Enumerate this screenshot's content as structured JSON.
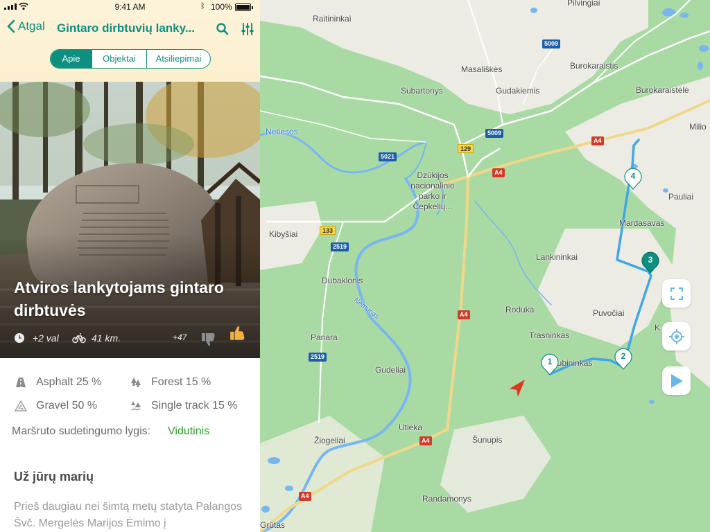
{
  "status_bar": {
    "time": "9:41 AM",
    "battery": "100%"
  },
  "nav": {
    "back_label": "Atgal",
    "title": "Gintaro dirbtuvių lanky...",
    "icons": {
      "search": "search-icon",
      "filter": "filter-sliders-icon"
    }
  },
  "tabs": [
    {
      "label": "Apie",
      "active": true
    },
    {
      "label": "Objektai",
      "active": false
    },
    {
      "label": "Atsiliepimai",
      "active": false
    }
  ],
  "hero": {
    "title": "Atviros lankytojams gintaro dirbtuvės",
    "duration": "+2 val",
    "distance": "41 km.",
    "likes": "+47"
  },
  "surfaces": [
    {
      "label": "Asphalt 25 %",
      "icon": "asphalt-icon"
    },
    {
      "label": "Forest 15 %",
      "icon": "forest-icon"
    },
    {
      "label": "Gravel 50 %",
      "icon": "gravel-icon"
    },
    {
      "label": "Single track 15 %",
      "icon": "single-track-icon"
    }
  ],
  "difficulty": {
    "label": "Maršruto sudetingumo lygis:",
    "value": "Vidutinis"
  },
  "description": {
    "title": "Už jūrų marių",
    "text": "Prieš daugiau nei šimtą metų statyta Palangos Švč. Mergelės Marijos Ėmimo į"
  },
  "map": {
    "places": [
      "Pilvingiai",
      "Raitininkai",
      "Masališkės",
      "Burokaraistis",
      "Subartonys",
      "Gudakiemis",
      "Burokaraistėlė",
      "Milio",
      "Netiesos",
      "Pauliai",
      "Mardasavas",
      "Kibyšiai",
      "Lankininkai",
      "Dubaklonis",
      "Roduka",
      "Puvočiai",
      "Trasninkas",
      "Dubininkas",
      "Panara",
      "Gudeliai",
      "Utieka",
      "Žiogeliai",
      "Šunupis",
      "Randamonys",
      "Grūtas",
      "Nemunas",
      "K"
    ],
    "park_label": [
      "Dzūkijos",
      "nacionalinio",
      "parko ir",
      "Čepkelių..."
    ],
    "shields": [
      "5009",
      "5009",
      "5021",
      "129",
      "A4",
      "A4",
      "133",
      "2519",
      "A4",
      "2519",
      "A4",
      "A4"
    ],
    "markers": [
      "1",
      "2",
      "3",
      "4"
    ],
    "accent": "#0f8f7f",
    "route_color": "#3ea7e8",
    "controls": [
      "expand-icon",
      "locate-icon",
      "play-icon"
    ]
  }
}
